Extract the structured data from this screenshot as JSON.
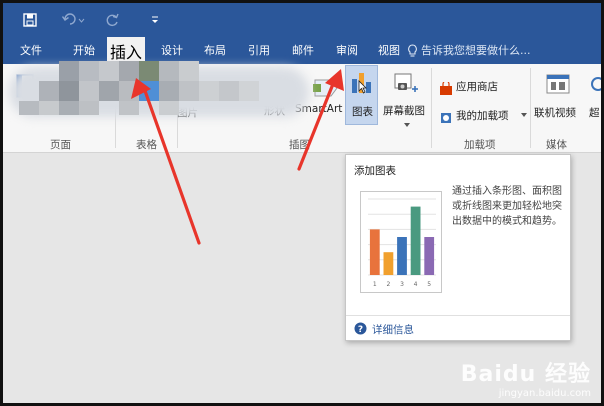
{
  "quick_access": {
    "save_icon": "save-icon",
    "undo_icon": "undo-icon",
    "redo_icon": "redo-icon",
    "customize_icon": "qat-dropdown-icon"
  },
  "menu": {
    "tabs": [
      "文件",
      "开始",
      "插入",
      "设计",
      "布局",
      "引用",
      "邮件",
      "审阅",
      "视图"
    ],
    "active_tab": "插入",
    "tell_me": "告诉我您想要做什么..."
  },
  "ribbon": {
    "groups": [
      "页面",
      "表格",
      "插图",
      "加载项",
      "媒体"
    ],
    "illustrations": {
      "pictures_label": "图片",
      "shapes_label": "形状",
      "smartart_label": "SmartArt",
      "chart_label": "图表",
      "screenshot_label": "屏幕截图"
    },
    "addins": {
      "store_label": "应用商店",
      "my_addins_label": "我的加载项"
    },
    "media": {
      "online_video_label": "联机视频",
      "links_label": "超"
    }
  },
  "tooltip": {
    "title": "添加图表",
    "description": "通过插入条形图、面积图或折线图来更加轻松地突出数据中的模式和趋势。",
    "more_info": "详细信息",
    "preview_bars": [
      6,
      3,
      5,
      9,
      5
    ],
    "preview_colors": [
      "#e8733c",
      "#f1a02d",
      "#3b73b9",
      "#4a9a80",
      "#8a69b3"
    ],
    "preview_ticks": [
      "1",
      "2",
      "3",
      "4",
      "5"
    ]
  },
  "watermark": {
    "logo": "Baidu 经验",
    "url": "jingyan.baidu.com"
  },
  "colors": {
    "word_blue": "#2b579a",
    "annotation_red": "#e8352b"
  }
}
